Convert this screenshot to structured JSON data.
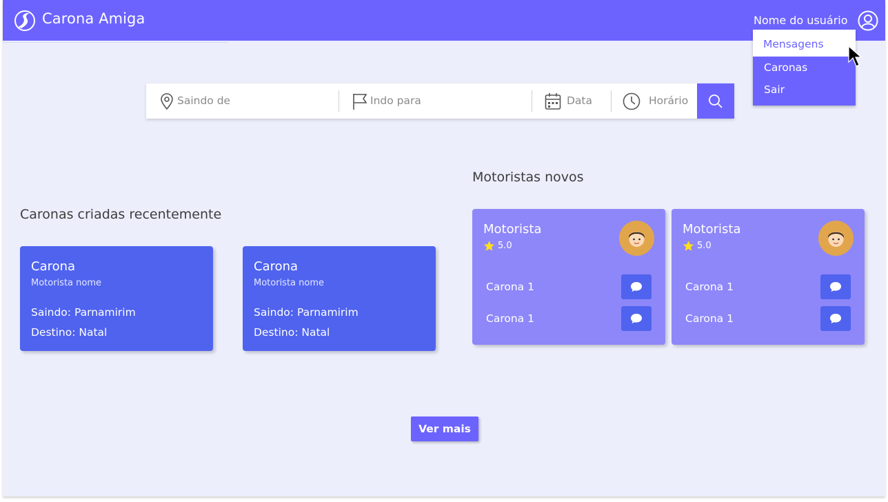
{
  "header": {
    "brand": "Carona Amiga",
    "user_name": "Nome do usuário",
    "logo_icon": "road-logo-icon",
    "user_icon": "user-circle-icon"
  },
  "user_menu": {
    "items": [
      {
        "label": "Mensagens",
        "active": true
      },
      {
        "label": "Caronas",
        "active": false
      },
      {
        "label": "Sair",
        "active": false
      }
    ]
  },
  "search": {
    "from_placeholder": "Saindo de",
    "to_placeholder": "Indo para",
    "date_placeholder": "Data",
    "time_placeholder": "Horário",
    "icons": [
      "map-pin-icon",
      "flag-icon",
      "calendar-icon",
      "clock-icon",
      "search-icon"
    ]
  },
  "recent_rides": {
    "title": "Caronas criadas recentemente",
    "cards": [
      {
        "title": "Carona",
        "driver": "Motorista nome",
        "from": "Saindo: Parnamirim",
        "to": "Destino: Natal"
      },
      {
        "title": "Carona",
        "driver": "Motorista nome",
        "from": "Saindo: Parnamirim",
        "to": "Destino: Natal"
      }
    ]
  },
  "new_drivers": {
    "title": "Motoristas novos",
    "cards": [
      {
        "name": "Motorista",
        "rating": "5.0",
        "rides": [
          "Carona 1",
          "Carona 1"
        ]
      },
      {
        "name": "Motorista",
        "rating": "5.0",
        "rides": [
          "Carona 1",
          "Carona 1"
        ]
      }
    ]
  },
  "more_button": "Ver mais",
  "colors": {
    "primary": "#6c63ff",
    "card_blue": "#4f63ef",
    "card_lilac": "#8e87f9",
    "background": "#eceefc"
  }
}
